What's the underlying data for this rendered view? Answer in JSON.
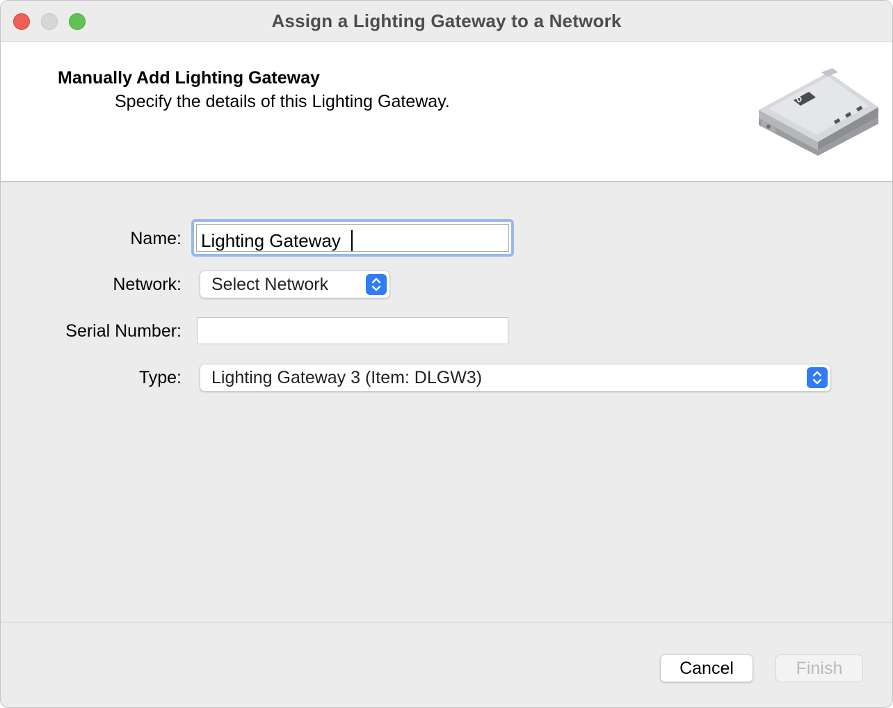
{
  "window": {
    "title": "Assign a Lighting Gateway to a Network"
  },
  "header": {
    "title": "Manually Add Lighting Gateway",
    "subtitle": "Specify the details of this Lighting Gateway.",
    "image_icon": "lighting-gateway-device"
  },
  "form": {
    "name_label": "Name:",
    "name_value": "Lighting Gateway ",
    "network_label": "Network:",
    "network_value": "Select Network",
    "serial_label": "Serial Number:",
    "serial_value": "",
    "type_label": "Type:",
    "type_value": "Lighting Gateway 3 (Item: DLGW3)"
  },
  "buttons": {
    "cancel": "Cancel",
    "finish": "Finish"
  },
  "colors": {
    "accent": "#2f7cf6",
    "focus_ring": "#97b8ec",
    "close": "#ee5f57",
    "zoom": "#5fc453"
  }
}
